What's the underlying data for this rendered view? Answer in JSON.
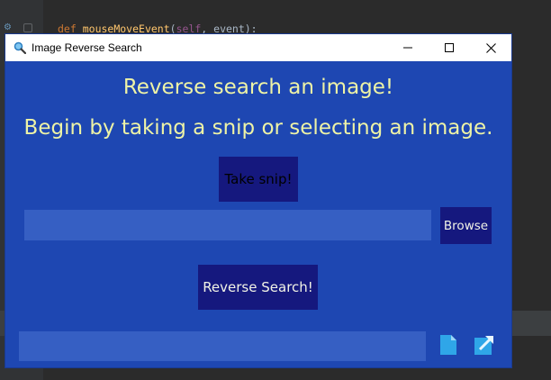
{
  "background_ide": {
    "code_line": {
      "kw": "def",
      "fn": "mouseMoveEvent",
      "open": "(",
      "self": "self",
      "rest": ", event):"
    }
  },
  "window": {
    "title": "Image Reverse Search",
    "icon": "magnifier-icon",
    "controls": {
      "minimize": "minimize-icon",
      "maximize": "maximize-icon",
      "close": "close-icon"
    }
  },
  "main": {
    "heading": "Reverse search an image!",
    "subheading": "Begin by taking a snip or selecting an image.",
    "snip_button": "Take snip!",
    "path_input": {
      "value": "",
      "placeholder": ""
    },
    "browse_button": "Browse",
    "reverse_button": "Reverse Search!",
    "result_input": {
      "value": "",
      "placeholder": ""
    },
    "copy_icon": "document-icon",
    "open_icon": "open-external-icon"
  },
  "colors": {
    "window_bg": "#1e47b2",
    "button_bg": "#15187e",
    "field_bg": "#365fc3",
    "heading_text": "#eef3a6",
    "icon_accent": "#2fa6e8"
  }
}
